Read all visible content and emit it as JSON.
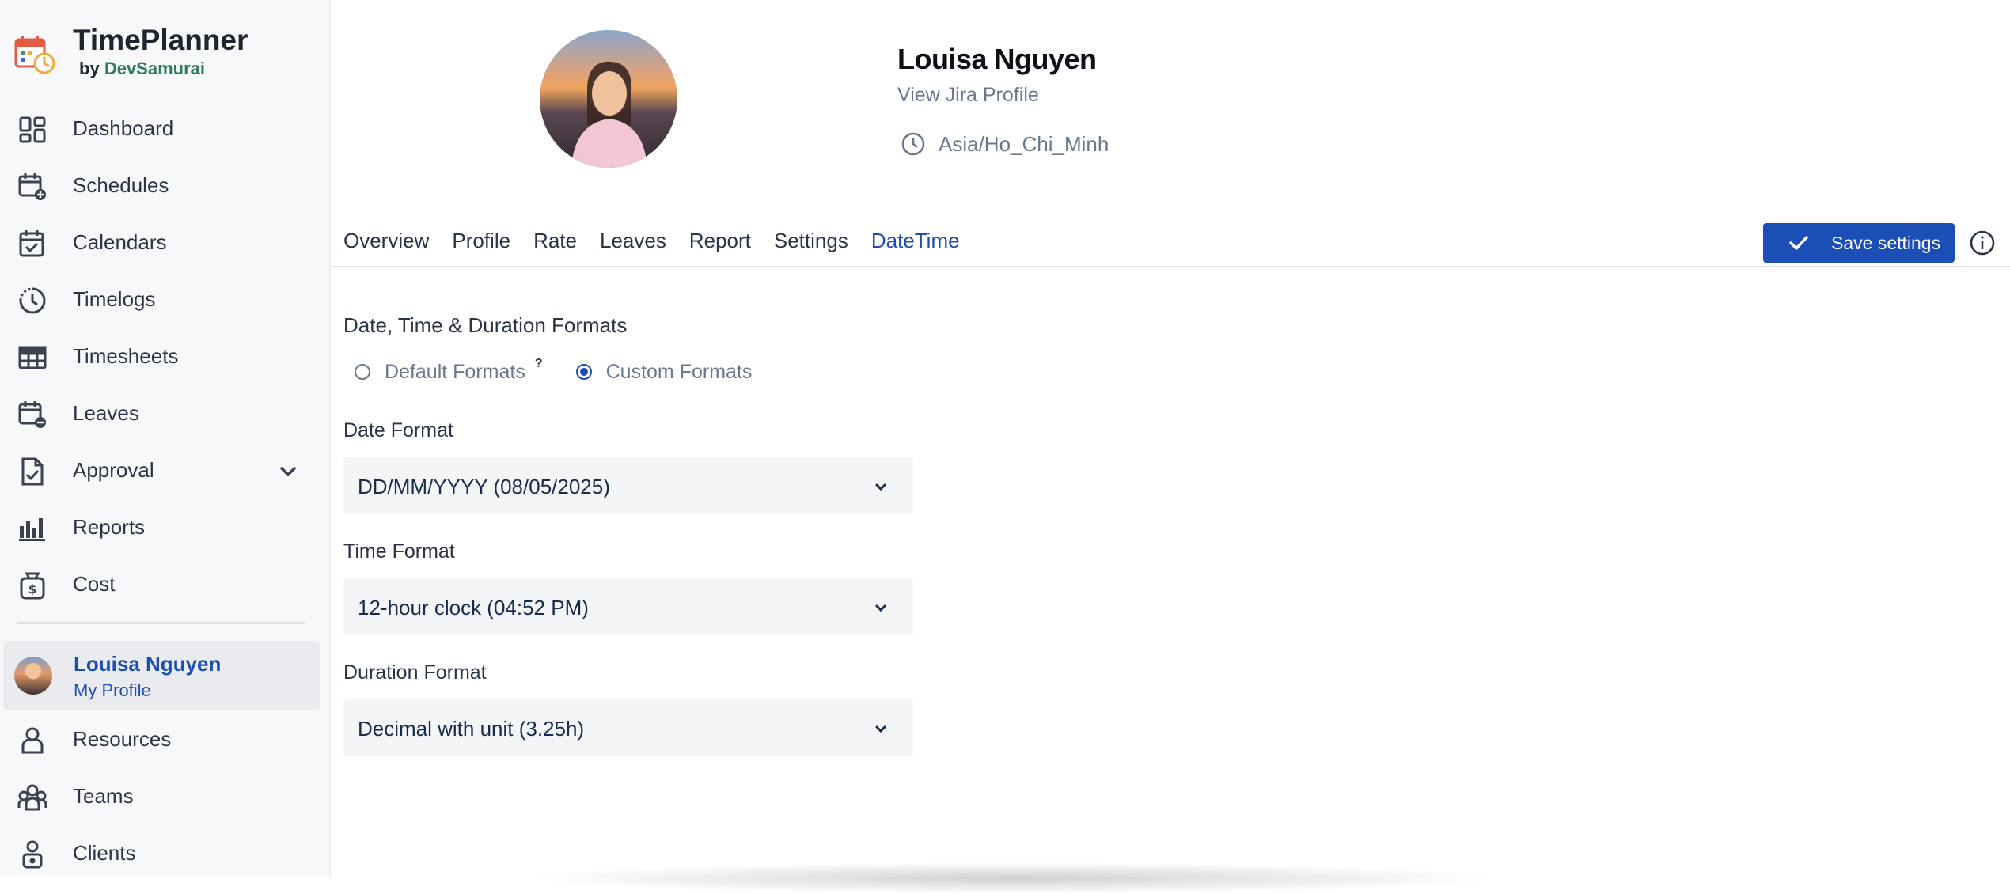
{
  "brand": {
    "name": "TimePlanner",
    "by": "by",
    "org": "DevSamurai"
  },
  "sidebar": {
    "items": [
      {
        "label": "Dashboard",
        "icon": "dashboard-icon"
      },
      {
        "label": "Schedules",
        "icon": "calendar-plus-icon"
      },
      {
        "label": "Calendars",
        "icon": "calendar-check-icon"
      },
      {
        "label": "Timelogs",
        "icon": "clock-history-icon"
      },
      {
        "label": "Timesheets",
        "icon": "table-icon"
      },
      {
        "label": "Leaves",
        "icon": "calendar-minus-icon"
      },
      {
        "label": "Approval",
        "icon": "file-check-icon"
      },
      {
        "label": "Reports",
        "icon": "bar-chart-icon"
      },
      {
        "label": "Cost",
        "icon": "money-bag-icon"
      }
    ],
    "profile": {
      "name": "Louisa Nguyen",
      "sub": "My Profile"
    },
    "items_after": [
      {
        "label": "Resources",
        "icon": "person-icon"
      },
      {
        "label": "Teams",
        "icon": "team-icon"
      },
      {
        "label": "Clients",
        "icon": "client-lock-icon"
      }
    ]
  },
  "header": {
    "user_name": "Louisa Nguyen",
    "jira_link": "View Jira Profile",
    "timezone": "Asia/Ho_Chi_Minh"
  },
  "tabs": [
    {
      "label": "Overview",
      "active": false
    },
    {
      "label": "Profile",
      "active": false
    },
    {
      "label": "Rate",
      "active": false
    },
    {
      "label": "Leaves",
      "active": false
    },
    {
      "label": "Report",
      "active": false
    },
    {
      "label": "Settings",
      "active": false
    },
    {
      "label": "DateTime",
      "active": true
    }
  ],
  "toolbar": {
    "save_label": "Save settings"
  },
  "form": {
    "section_title": "Date, Time & Duration Formats",
    "radio_default": "Default Formats",
    "radio_default_help": "?",
    "radio_custom": "Custom Formats",
    "selected_mode": "custom",
    "date_label": "Date Format",
    "date_value": "DD/MM/YYYY (08/05/2025)",
    "time_label": "Time Format",
    "time_value": "12-hour clock (04:52 PM)",
    "duration_label": "Duration Format",
    "duration_value": "Decimal with unit (3.25h)"
  },
  "colors": {
    "accent": "#1c4fb6",
    "sidebar_bg": "#f7f8fa",
    "select_bg": "#f4f5f7"
  }
}
